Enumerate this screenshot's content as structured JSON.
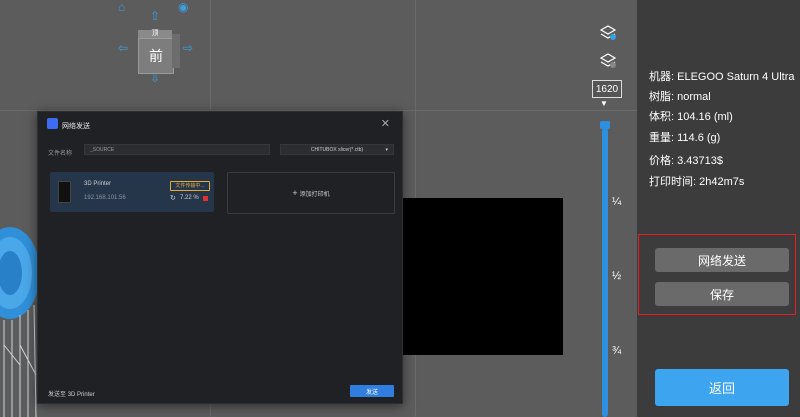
{
  "viewport": {
    "view_cube": {
      "front_label": "前",
      "top_label": "顶"
    }
  },
  "slider": {
    "layer_value": "1620",
    "ticks": [
      "¼",
      "½",
      "¾"
    ]
  },
  "info": {
    "rows": [
      {
        "label": "机器:",
        "value": "ELEGOO Saturn 4 Ultra"
      },
      {
        "label": "树脂:",
        "value": "normal"
      },
      {
        "label": "体积:",
        "value": "104.16 (ml)"
      },
      {
        "label": "重量:",
        "value": "114.6 (g)"
      },
      {
        "label": "价格:",
        "value": "3.43713$"
      },
      {
        "label": "打印时间:",
        "value": "2h42m7s"
      }
    ],
    "network_send_label": "网络发送",
    "save_label": "保存",
    "back_label": "返回",
    "highlight_color": "#e02020",
    "accent_color": "#3da4f0"
  },
  "dialog": {
    "title": "网络发送",
    "file_label": "文件名称",
    "file_value": "_SOURCE",
    "format_value": "CHITUBOX slicer(*.ctb)",
    "printer": {
      "name": "3D Printer",
      "ip": "192.168.101.56",
      "badge": "文件传输中...",
      "progress": "7.22 %"
    },
    "add_printer_label": "添加打印机",
    "send_to_label": "发送至",
    "send_to_value": "3D Printer",
    "send_button": "发送"
  }
}
